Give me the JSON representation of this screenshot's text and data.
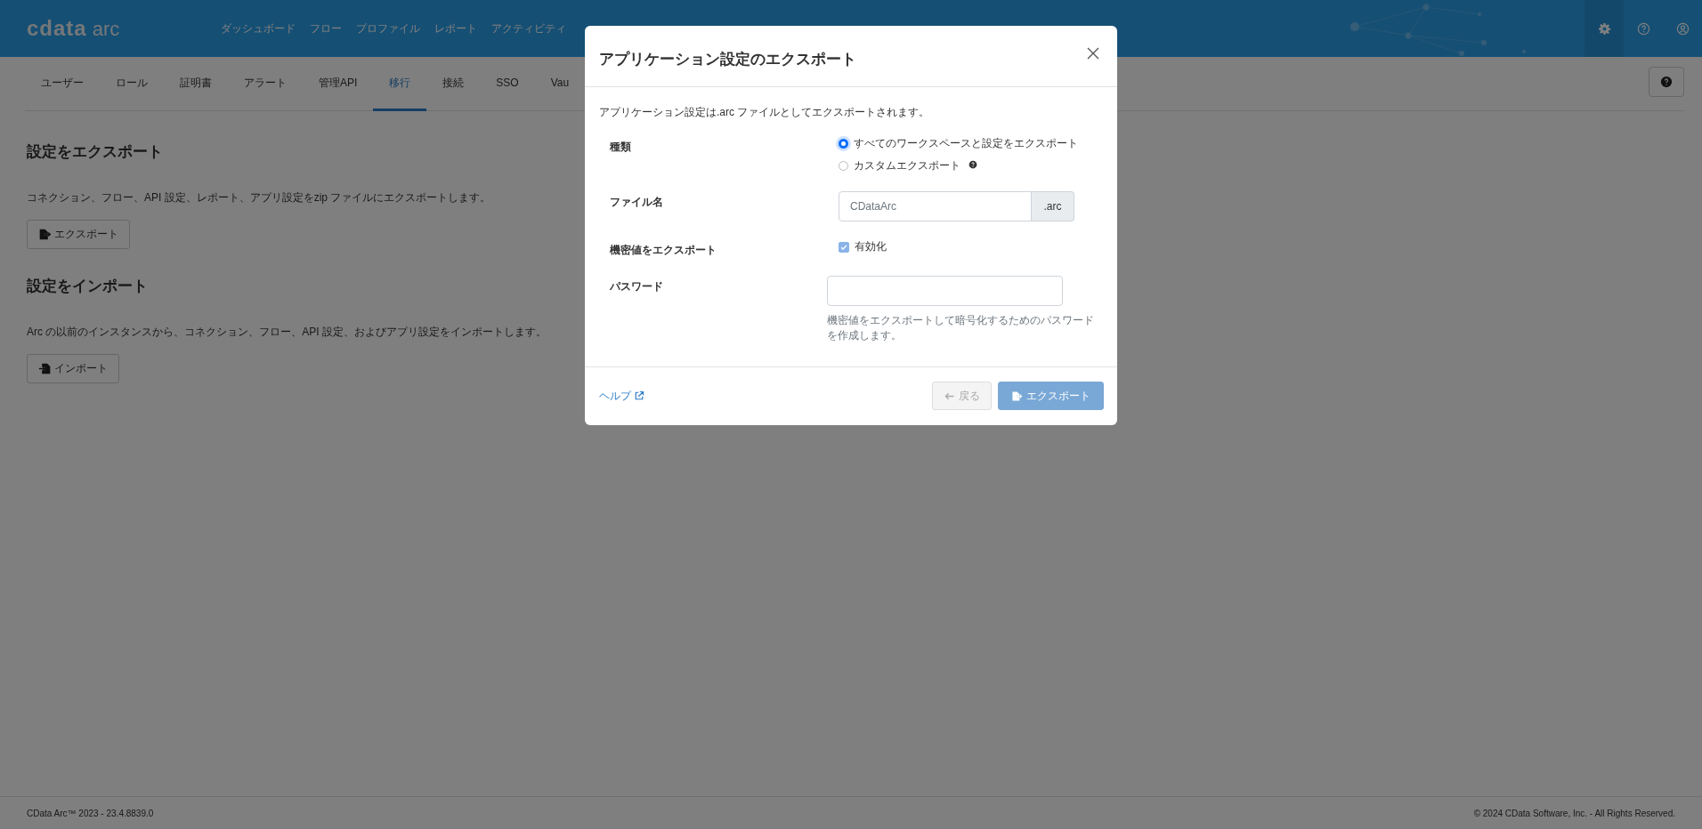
{
  "header": {
    "logo": "cdata",
    "logo_suffix": "arc",
    "nav": [
      {
        "label": "ダッシュボード"
      },
      {
        "label": "フロー"
      },
      {
        "label": "プロファイル"
      },
      {
        "label": "レポート"
      },
      {
        "label": "アクティビティ"
      }
    ]
  },
  "subnav": {
    "tabs": [
      {
        "label": "ユーザー",
        "selected": false
      },
      {
        "label": "ロール",
        "selected": false
      },
      {
        "label": "証明書",
        "selected": false
      },
      {
        "label": "アラート",
        "selected": false
      },
      {
        "label": "管理API",
        "selected": false
      },
      {
        "label": "移行",
        "selected": true
      },
      {
        "label": "接続",
        "selected": false
      },
      {
        "label": "SSO",
        "selected": false
      },
      {
        "label": "Vau",
        "selected": false
      }
    ]
  },
  "sections": [
    {
      "title": "設定をエクスポート",
      "description": "コネクション、フロー、API 設定、レポート、アプリ設定をzip ファイルにエクスポートします。",
      "button": {
        "label": "エクスポート",
        "kind": "export"
      }
    },
    {
      "title": "設定をインポート",
      "description": "Arc の以前のインスタンスから、コネクション、フロー、API 設定、およびアプリ設定をインポートします。",
      "button": {
        "label": "インポート",
        "kind": "import"
      }
    }
  ],
  "modal": {
    "title": "アプリケーション設定のエクスポート",
    "description": "アプリケーション設定は.arc ファイルとしてエクスポートされます。",
    "fields": [
      {
        "kind": "radio",
        "label": "種類",
        "options": [
          {
            "label": "すべてのワークスペースと設定をエクスポート",
            "selected": true,
            "help": false
          },
          {
            "label": "カスタムエクスポート",
            "selected": false,
            "help": true
          }
        ]
      },
      {
        "kind": "addon",
        "label": "ファイル名",
        "placeholder": "CDataArc",
        "addon": ".arc"
      },
      {
        "kind": "checkbox",
        "label": "機密値をエクスポート",
        "option": "有効化",
        "checked": true,
        "disabled": true
      },
      {
        "kind": "password",
        "label": "パスワード",
        "hint": "機密値をエクスポートして暗号化するためのパスワードを作成します。"
      }
    ],
    "help_link": "ヘルプ",
    "buttons": [
      {
        "label": "戻る",
        "kind": "back",
        "disabled": true
      },
      {
        "label": "エクスポート",
        "kind": "export",
        "disabled": true
      }
    ]
  },
  "footer": {
    "left": "CData Arc™ 2023 - 23.4.8839.0",
    "right": "© 2024 CData Software, Inc. - All Rights Reserved."
  }
}
